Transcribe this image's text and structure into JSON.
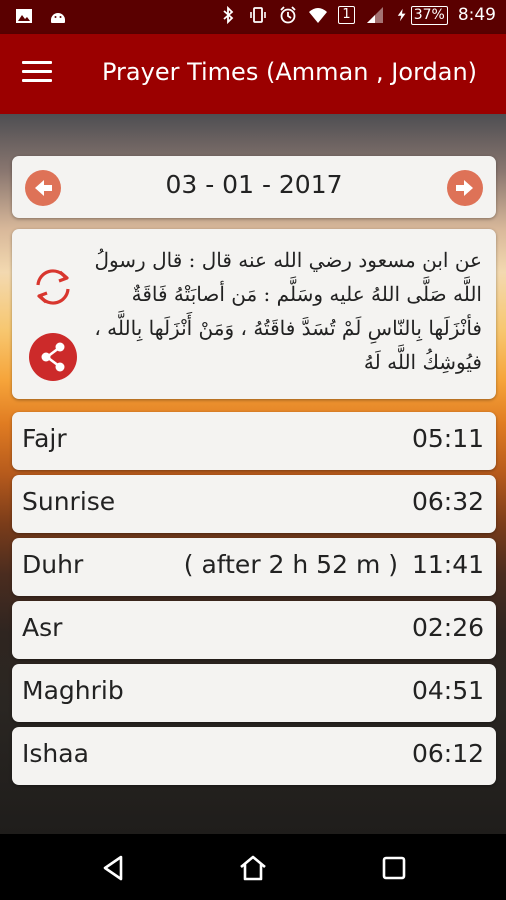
{
  "status_bar": {
    "sim_indicator": "1",
    "battery": "37%",
    "time": "8:49"
  },
  "app_bar": {
    "title": "Prayer Times (Amman , Jordan)"
  },
  "date_nav": {
    "date": "03 - 01 - 2017"
  },
  "hadith": {
    "text": "عن ابن مسعود رضي الله عنه قال : قال رسولُ اللَّه صَلَّى اللهُ عليه وسَلَّم : مَن أصابَتْهُ فَاقَةٌ فأنْزَلَها بِالنّاسِ لَمْ تُسَدَّ فاقَتُهُ ، وَمَنْ أَنْزَلَها بِاللَّه ، فيُوشِكُ اللَّه لَهُ"
  },
  "prayers": [
    {
      "name": "Fajr",
      "note": "",
      "time": "05:11"
    },
    {
      "name": "Sunrise",
      "note": "",
      "time": "06:32"
    },
    {
      "name": "Duhr",
      "note": "( after 2 h 52 m )",
      "time": "11:41"
    },
    {
      "name": "Asr",
      "note": "",
      "time": "02:26"
    },
    {
      "name": "Maghrib",
      "note": "",
      "time": "04:51"
    },
    {
      "name": "Ishaa",
      "note": "",
      "time": "06:12"
    }
  ],
  "colors": {
    "status_bar": "#5a0000",
    "app_bar": "#9b0000",
    "arrow_button": "#de7257",
    "share_button": "#cc2a2a",
    "refresh_icon": "#d8362e"
  }
}
